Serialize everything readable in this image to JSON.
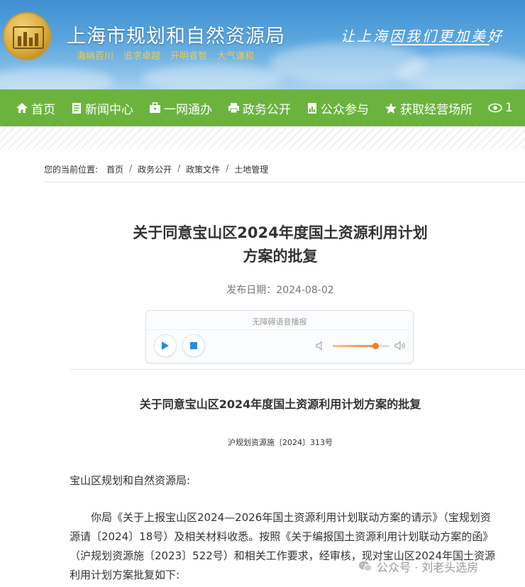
{
  "header": {
    "site_title": "上海市规划和自然资源局",
    "mottos": [
      "海纳百川",
      "追求卓越",
      "开明睿智",
      "大气谦和"
    ],
    "slogan": "让上海因我们更加美好"
  },
  "nav": {
    "items": [
      {
        "label": "首页",
        "icon": "home-icon"
      },
      {
        "label": "新闻中心",
        "icon": "document-icon"
      },
      {
        "label": "一网通办",
        "icon": "briefcase-icon"
      },
      {
        "label": "政务公开",
        "icon": "printer-icon"
      },
      {
        "label": "公众参与",
        "icon": "chart-doc-icon"
      },
      {
        "label": "获取经营场所",
        "icon": "star-icon"
      },
      {
        "label": "1",
        "icon": "eye-icon"
      }
    ]
  },
  "breadcrumb": {
    "label": "您的当前位置:",
    "items": [
      "首页",
      "政务公开",
      "政策文件",
      "土地管理"
    ],
    "separator": "/"
  },
  "article": {
    "title_line1": "关于同意宝山区2024年度国土资源利用计划",
    "title_line2": "方案的批复",
    "publish_date": "发布日期：2024-08-02",
    "doc_title": "关于同意宝山区2024年度国土资源利用计划方案的批复",
    "doc_number": "沪规划资源施〔2024〕313号",
    "addressee": "宝山区规划和自然资源局:",
    "body": "你局《关于上报宝山区2024—2026年国土资源利用计划联动方案的请示》（宝规划资源请〔2024〕18号）及相关材料收悉。按照《关于编报国土资源利用计划联动方案的函》（沪规划资源施〔2023〕522号）和相关工作要求，经审核，现对宝山区2024年国土资源利用计划方案批复如下:"
  },
  "player": {
    "title": "无障碍语音播报",
    "volume": 0.75
  },
  "watermark": {
    "text": "公众号 · 刘老头选房"
  },
  "colors": {
    "nav_bg": "#6cb33e",
    "banner_top": "#3f8fd0",
    "motto": "#f2c94c",
    "volume": "#f07c2a"
  }
}
